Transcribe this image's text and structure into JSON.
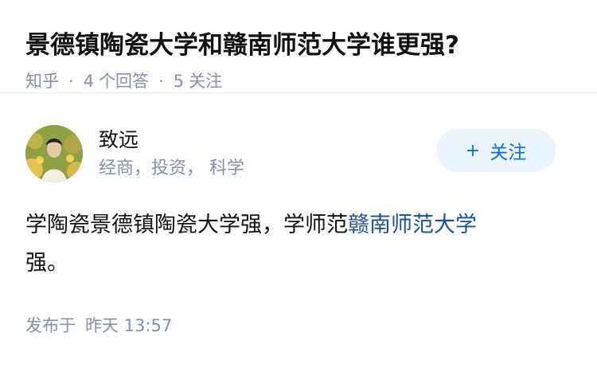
{
  "question": {
    "title": "景德镇陶瓷大学和赣南师范大学谁更强?",
    "source": "知乎",
    "answer_count": "4",
    "answer_label": "个回答",
    "follower_count": "5",
    "follower_label": "关注",
    "separator": "·"
  },
  "answer": {
    "author": {
      "name": "致远",
      "bio": "经商，投资， 科学"
    },
    "follow_button": {
      "icon": "+",
      "label": "关注"
    },
    "content": {
      "text_before": "学陶瓷景德镇陶瓷大学强，学师范",
      "link_text": "赣南师范大学",
      "text_after": "强。"
    },
    "publish": {
      "prefix": "发布于",
      "time": "昨天 13:57"
    }
  },
  "colors": {
    "primary": "#056de8",
    "link": "#175199",
    "meta": "#8590a6",
    "follow_bg": "#ebf5fd"
  }
}
